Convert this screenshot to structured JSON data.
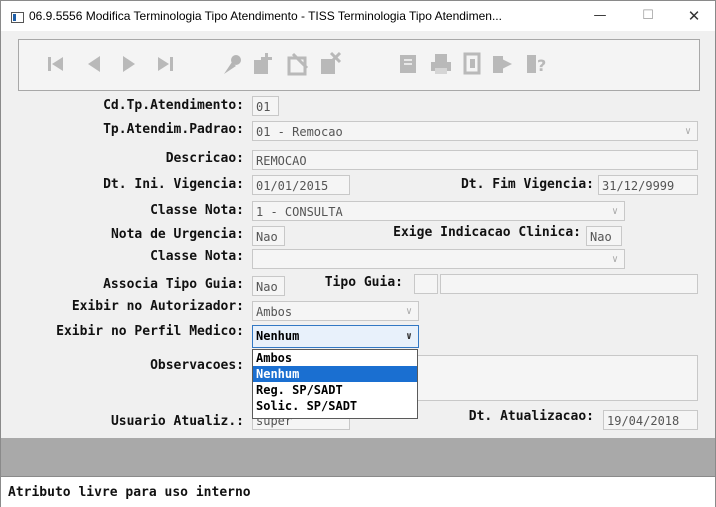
{
  "window": {
    "title": "06.9.5556 Modifica Terminologia Tipo Atendimento - TISS Terminologia Tipo Atendimen...",
    "minimize": "—",
    "maximize": "☐",
    "close": "✕"
  },
  "toolbar": {
    "buttons": [
      "first-icon",
      "prev-icon",
      "next-icon",
      "last-icon",
      "edit-icon",
      "add-icon",
      "cut-icon",
      "remove-icon",
      "filter-icon",
      "print-icon",
      "copy-icon",
      "exit-icon",
      "help-icon"
    ]
  },
  "form": {
    "cd_tp_atendimento": {
      "label": "Cd.Tp.Atendimento:",
      "value": "01"
    },
    "tp_atendim_padrao": {
      "label": "Tp.Atendim.Padrao:",
      "value": "01 - Remocao"
    },
    "descricao": {
      "label": "Descricao:",
      "value": "REMOCAO"
    },
    "dt_ini_vigencia": {
      "label": "Dt. Ini. Vigencia:",
      "value": "01/01/2015"
    },
    "dt_fim_vigencia": {
      "label": "Dt. Fim Vigencia:",
      "value": "31/12/9999"
    },
    "classe_nota_1": {
      "label": "Classe Nota:",
      "value": "1 - CONSULTA"
    },
    "nota_urgencia": {
      "label": "Nota de Urgencia:",
      "value": "Nao"
    },
    "exige_indicacao": {
      "label": "Exige Indicacao Clinica:",
      "value": "Nao"
    },
    "classe_nota_2": {
      "label": "Classe Nota:",
      "value": ""
    },
    "associa_tipo_guia": {
      "label": "Associa Tipo Guia:",
      "value": "Nao"
    },
    "tipo_guia": {
      "label": "Tipo Guia:",
      "value": ""
    },
    "exibir_autorizador": {
      "label": "Exibir no Autorizador:",
      "value": "Ambos"
    },
    "exibir_perfil_medico": {
      "label": "Exibir no Perfil Medico:",
      "value": "Nenhum",
      "options": [
        "Ambos",
        "Nenhum",
        "Reg. SP/SADT",
        "Solic. SP/SADT"
      ],
      "selected_index": 1
    },
    "observacoes": {
      "label": "Observacoes:",
      "value": ""
    },
    "usuario_atualiz": {
      "label": "Usuario Atualiz.:",
      "value": "super"
    },
    "dt_atualizacao": {
      "label": "Dt. Atualizacao:",
      "value": "19/04/2018"
    }
  },
  "status_bar": {
    "text": "Atributo livre para uso interno"
  }
}
